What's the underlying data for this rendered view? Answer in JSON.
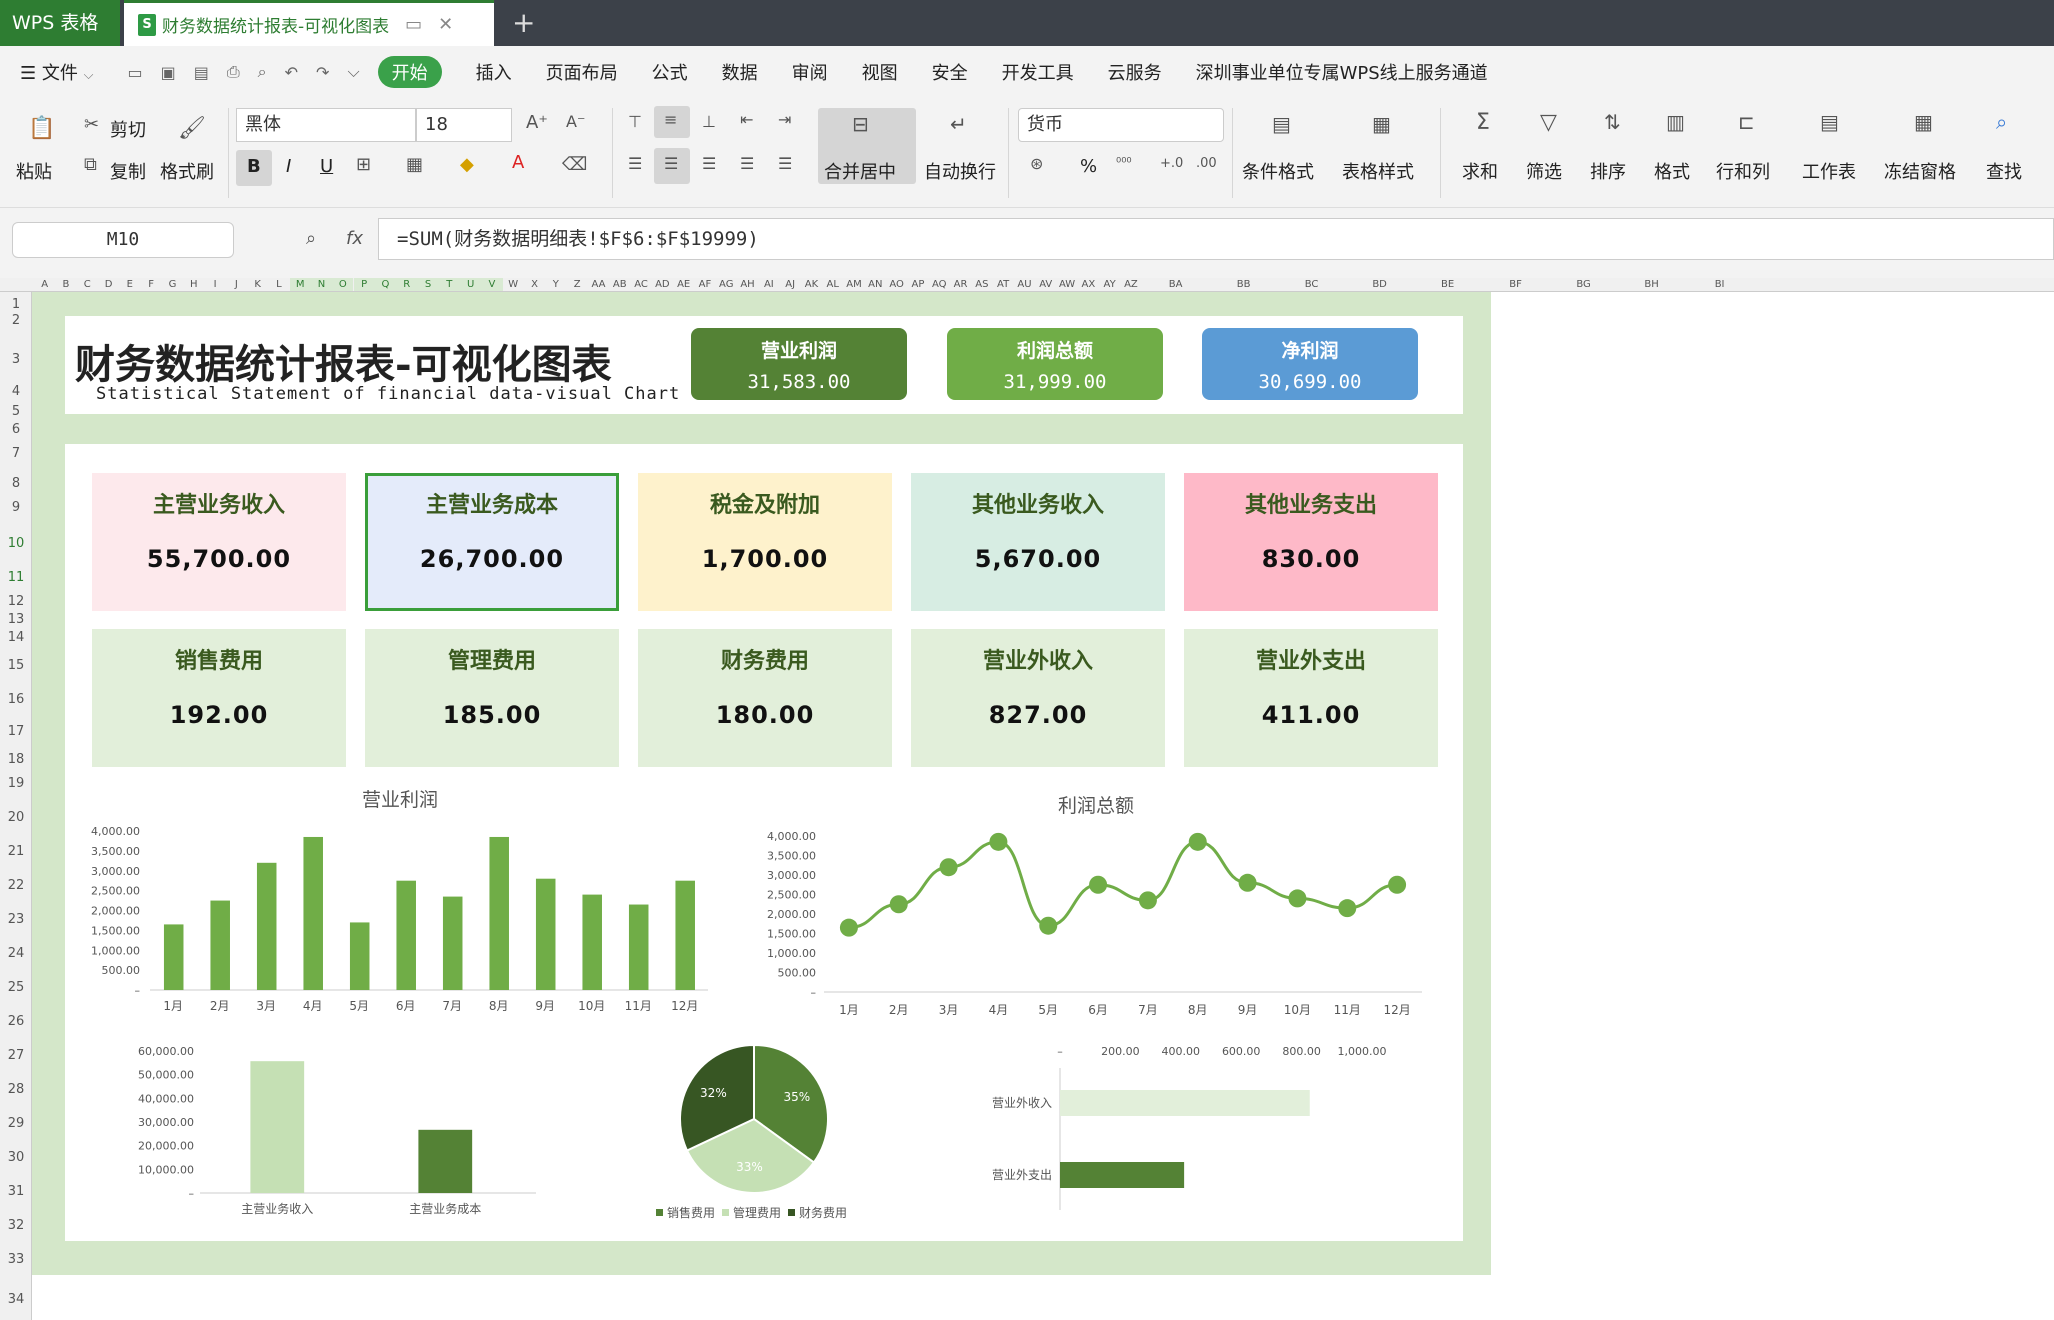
{
  "titlebar": {
    "app": "WPS 表格",
    "doc_tab": "财务数据统计报表-可视化图表",
    "file_icon_letter": "S",
    "new_tab": "+"
  },
  "menubar": {
    "file": "文件",
    "tabs": [
      "开始",
      "插入",
      "页面布局",
      "公式",
      "数据",
      "审阅",
      "视图",
      "安全",
      "开发工具",
      "云服务",
      "深圳事业单位专属WPS线上服务通道"
    ],
    "active": "开始"
  },
  "ribbon": {
    "paste": "粘贴",
    "cut": "剪切",
    "copy": "复制",
    "format_painter": "格式刷",
    "font_name": "黑体",
    "font_size": "18",
    "merge_center": "合并居中",
    "wrap_text": "自动换行",
    "number_format": "货币",
    "cond_format": "条件格式",
    "table_style": "表格样式",
    "sum": "求和",
    "filter": "筛选",
    "sort": "排序",
    "format": "格式",
    "row_col": "行和列",
    "worksheet": "工作表",
    "freeze": "冻结窗格",
    "find": "查找",
    "bold": "B",
    "italic": "I",
    "underline": "U",
    "percent": "%"
  },
  "formula_bar": {
    "name_box": "M10",
    "fx": "fx",
    "formula": "=SUM(财务数据明细表!$F$6:$F$19999)"
  },
  "columns": [
    "A",
    "B",
    "C",
    "D",
    "E",
    "F",
    "G",
    "H",
    "I",
    "J",
    "K",
    "L",
    "M",
    "N",
    "O",
    "P",
    "Q",
    "R",
    "S",
    "T",
    "U",
    "V",
    "W",
    "X",
    "Y",
    "Z",
    "AA",
    "AB",
    "AC",
    "AD",
    "AE",
    "AF",
    "AG",
    "AH",
    "AI",
    "AJ",
    "AK",
    "AL",
    "AM",
    "AN",
    "AO",
    "AP",
    "AQ",
    "AR",
    "AS",
    "AT",
    "AU",
    "AV",
    "AW",
    "AX",
    "AY",
    "AZ",
    "BA",
    "BB",
    "BC",
    "BD",
    "BE",
    "BF",
    "BG",
    "BH",
    "BI"
  ],
  "rows": [
    "1",
    "2",
    "3",
    "4",
    "5",
    "6",
    "7",
    "8",
    "9",
    "10",
    "11",
    "12",
    "13",
    "14",
    "15",
    "16",
    "17",
    "18",
    "19",
    "20",
    "21",
    "22",
    "23",
    "24",
    "25",
    "26",
    "27",
    "28",
    "29",
    "30",
    "31",
    "32",
    "33",
    "34"
  ],
  "header": {
    "title": "财务数据统计报表-可视化图表",
    "subtitle": "Statistical Statement of financial data-visual Chart",
    "pills": [
      {
        "label": "营业利润",
        "value": "31,583.00",
        "color": "#548235"
      },
      {
        "label": "利润总额",
        "value": "31,999.00",
        "color": "#70ad47"
      },
      {
        "label": "净利润",
        "value": "30,699.00",
        "color": "#5b9bd5"
      }
    ]
  },
  "kpis": [
    {
      "label": "主营业务收入",
      "value": "55,700.00",
      "color": "#fde9ec"
    },
    {
      "label": "主营业务成本",
      "value": "26,700.00",
      "color": "#e4ebfa"
    },
    {
      "label": "税金及附加",
      "value": "1,700.00",
      "color": "#fef2cc"
    },
    {
      "label": "其他业务收入",
      "value": "5,670.00",
      "color": "#d7ede3"
    },
    {
      "label": "其他业务支出",
      "value": "830.00",
      "color": "#feb9c8"
    },
    {
      "label": "销售费用",
      "value": "192.00",
      "color": "#e2efda"
    },
    {
      "label": "管理费用",
      "value": "185.00",
      "color": "#e2efda"
    },
    {
      "label": "财务费用",
      "value": "180.00",
      "color": "#e2efda"
    },
    {
      "label": "营业外收入",
      "value": "827.00",
      "color": "#e2efda"
    },
    {
      "label": "营业外支出",
      "value": "411.00",
      "color": "#e2efda"
    }
  ],
  "chart_data": [
    {
      "type": "bar",
      "title": "营业利润",
      "categories": [
        "1月",
        "2月",
        "3月",
        "4月",
        "5月",
        "6月",
        "7月",
        "8月",
        "9月",
        "10月",
        "11月",
        "12月"
      ],
      "values": [
        1650,
        2250,
        3200,
        3850,
        1700,
        2750,
        2350,
        3850,
        2800,
        2400,
        2150,
        2750
      ],
      "ylim": [
        0,
        4000
      ],
      "yticks": [
        "–",
        "500.00",
        "1,000.00",
        "1,500.00",
        "2,000.00",
        "2,500.00",
        "3,000.00",
        "3,500.00",
        "4,000.00"
      ],
      "color": "#70ad47"
    },
    {
      "type": "line",
      "title": "利润总额",
      "categories": [
        "1月",
        "2月",
        "3月",
        "4月",
        "5月",
        "6月",
        "7月",
        "8月",
        "9月",
        "10月",
        "11月",
        "12月"
      ],
      "values": [
        1650,
        2250,
        3200,
        3850,
        1700,
        2750,
        2350,
        3850,
        2800,
        2400,
        2150,
        2750
      ],
      "ylim": [
        0,
        4000
      ],
      "yticks": [
        "–",
        "500.00",
        "1,000.00",
        "1,500.00",
        "2,000.00",
        "2,500.00",
        "3,000.00",
        "3,500.00",
        "4,000.00"
      ],
      "color": "#70ad47"
    },
    {
      "type": "bar",
      "categories": [
        "主营业务收入",
        "主营业务成本"
      ],
      "values": [
        55700,
        26700
      ],
      "colors": [
        "#c5e0b4",
        "#548235"
      ],
      "ylim": [
        0,
        60000
      ],
      "yticks": [
        "–",
        "10,000.00",
        "20,000.00",
        "30,000.00",
        "40,000.00",
        "50,000.00",
        "60,000.00"
      ]
    },
    {
      "type": "pie",
      "categories": [
        "销售费用",
        "管理费用",
        "财务费用"
      ],
      "values": [
        35,
        33,
        32
      ],
      "labels": [
        "35%",
        "33%",
        "32%"
      ],
      "colors": [
        "#548235",
        "#c5e0b4",
        "#375623"
      ],
      "legend": "bottom"
    },
    {
      "type": "bar",
      "orientation": "horizontal",
      "categories": [
        "营业外收入",
        "营业外支出"
      ],
      "values": [
        827,
        411
      ],
      "colors": [
        "#e2efda",
        "#548235"
      ],
      "xlim": [
        0,
        1000
      ],
      "xticks": [
        "–",
        "200.00",
        "400.00",
        "600.00",
        "800.00",
        "1,000.00"
      ]
    }
  ]
}
